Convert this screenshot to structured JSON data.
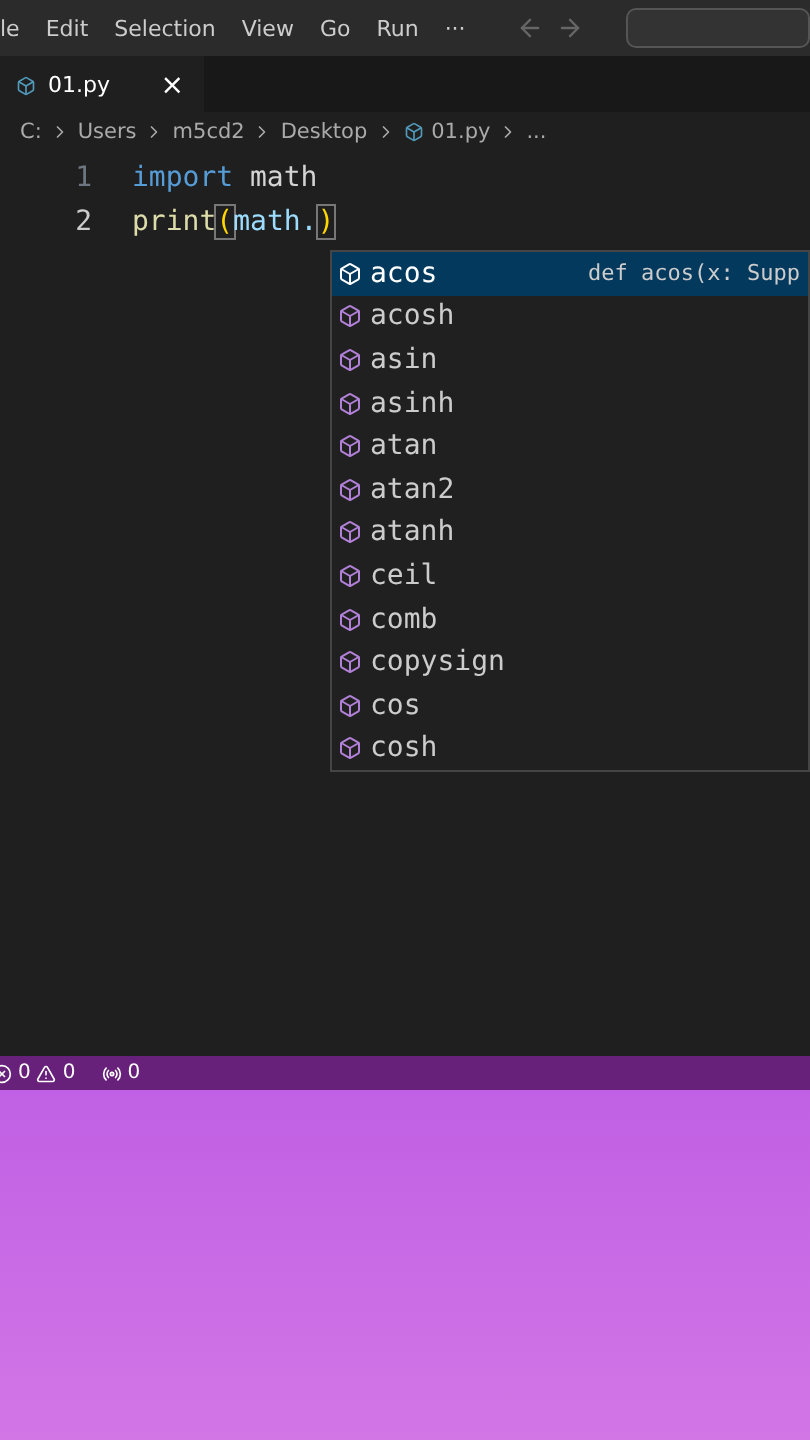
{
  "menu": [
    "le",
    "Edit",
    "Selection",
    "View",
    "Go",
    "Run",
    "···"
  ],
  "tab": {
    "label": "01.py",
    "close": "×",
    "selected": true
  },
  "breadcrumb": [
    "C:",
    "Users",
    "m5cd2",
    "Desktop",
    "01.py",
    "..."
  ],
  "code": [
    {
      "number": "1",
      "tokens": [
        {
          "kind": "keyword",
          "text": "import"
        },
        {
          "kind": "plain",
          "text": " math"
        }
      ]
    },
    {
      "number": "2",
      "tokens": [
        {
          "kind": "function",
          "text": "print"
        },
        {
          "kind": "bracket",
          "text": "("
        },
        {
          "kind": "variable",
          "text": "math."
        },
        {
          "kind": "bracket",
          "text": ")"
        }
      ]
    }
  ],
  "suggestions": [
    {
      "label": "acos",
      "selected": true,
      "detail": "def acos(x: Supp"
    },
    {
      "label": "acosh",
      "selected": false
    },
    {
      "label": "asin",
      "selected": false
    },
    {
      "label": "asinh",
      "selected": false
    },
    {
      "label": "atan",
      "selected": false
    },
    {
      "label": "atan2",
      "selected": false
    },
    {
      "label": "atanh",
      "selected": false
    },
    {
      "label": "ceil",
      "selected": false
    },
    {
      "label": "comb",
      "selected": false
    },
    {
      "label": "copysign",
      "selected": false
    },
    {
      "label": "cos",
      "selected": false
    },
    {
      "label": "cosh",
      "selected": false
    }
  ],
  "status": {
    "errors": "0",
    "warnings": "0",
    "ports": "0"
  }
}
